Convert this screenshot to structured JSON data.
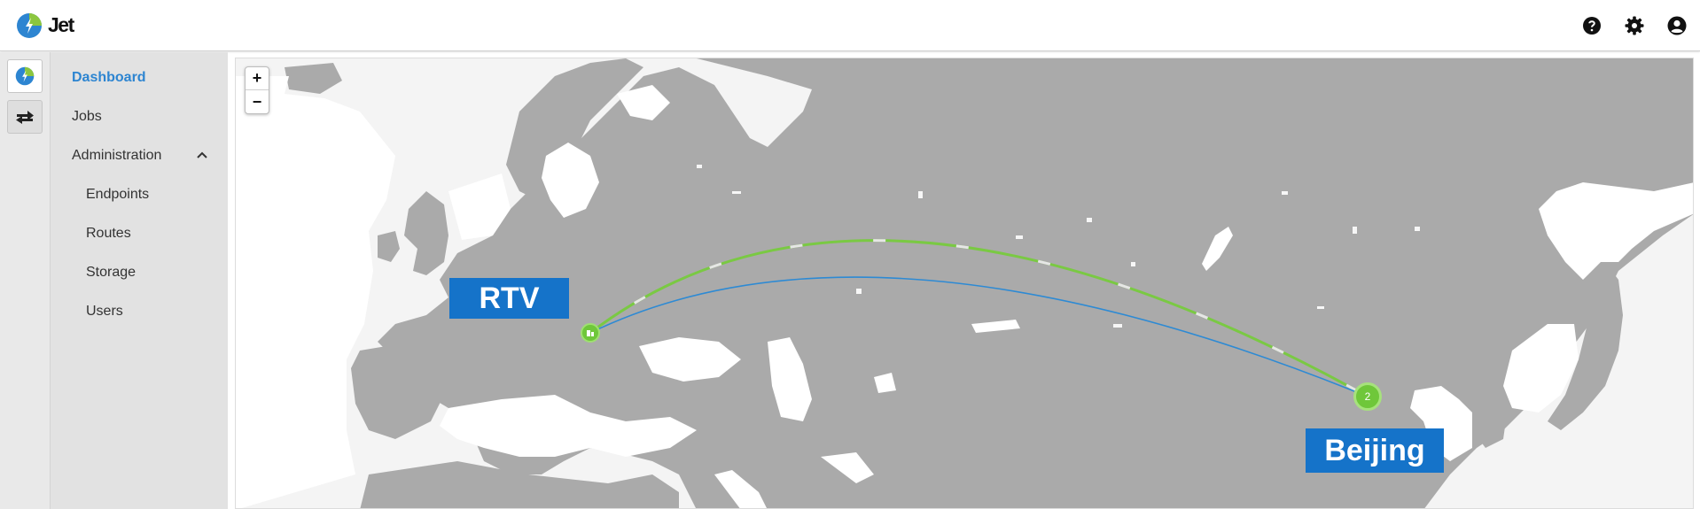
{
  "app": {
    "brand": "Jet"
  },
  "header": {
    "icons": [
      "help-icon",
      "gear-icon",
      "account-icon"
    ]
  },
  "rail": {
    "buttons": [
      "app-logo-icon",
      "swap-arrows-icon"
    ]
  },
  "nav": {
    "items": [
      {
        "label": "Dashboard",
        "active": true
      },
      {
        "label": "Jobs"
      },
      {
        "label": "Administration",
        "expanded": true
      },
      {
        "label": "Endpoints"
      },
      {
        "label": "Routes"
      },
      {
        "label": "Storage"
      },
      {
        "label": "Users"
      }
    ]
  },
  "map": {
    "zoom_in": "+",
    "zoom_out": "−",
    "locations": [
      {
        "name": "RTV"
      },
      {
        "name": "Beijing",
        "cluster_count": "2"
      }
    ],
    "colors": {
      "land": "#aaaaaa",
      "water": "#ffffff",
      "route_primary": "#7ac943",
      "route_secondary": "#2d8ad4",
      "label_bg": "#1573c9",
      "marker": "#6fc73a"
    }
  }
}
